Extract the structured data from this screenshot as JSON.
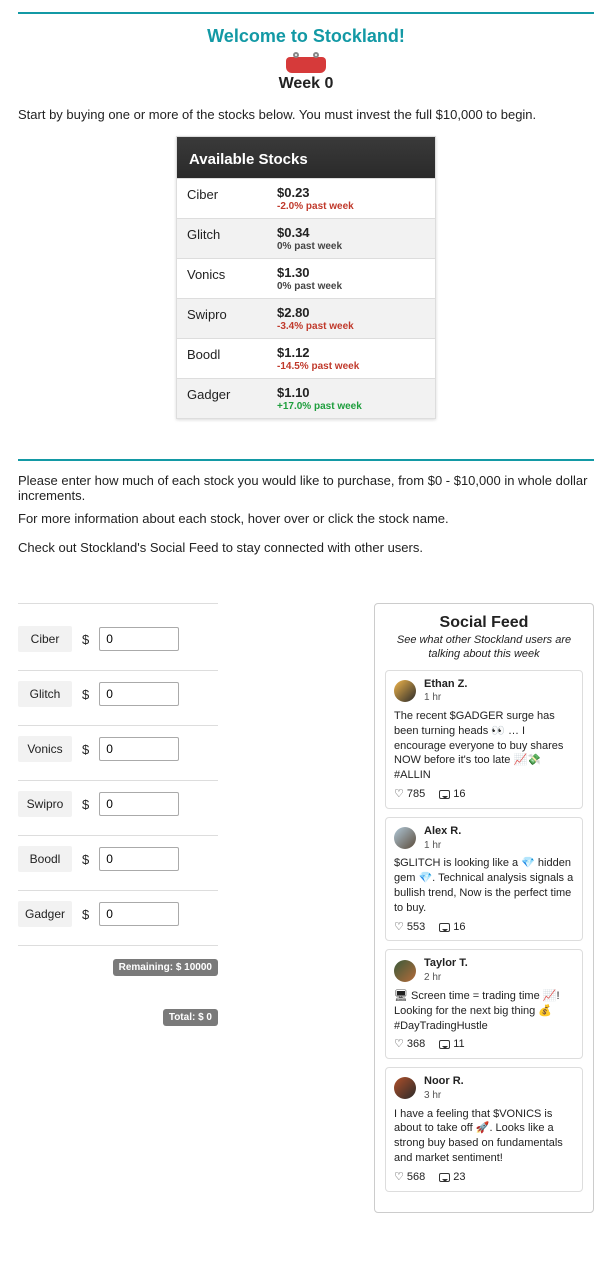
{
  "title": "Welcome to Stockland!",
  "week_label": "Week 0",
  "intro": "Start by buying one or more of the stocks below. You must invest the full $10,000 to begin.",
  "stocks_panel": {
    "heading": "Available Stocks",
    "rows": [
      {
        "name": "Ciber",
        "price": "$0.23",
        "delta": "-2.0% past week",
        "dir": "neg"
      },
      {
        "name": "Glitch",
        "price": "$0.34",
        "delta": "0% past week",
        "dir": "zero"
      },
      {
        "name": "Vonics",
        "price": "$1.30",
        "delta": "0% past week",
        "dir": "zero"
      },
      {
        "name": "Swipro",
        "price": "$2.80",
        "delta": "-3.4% past week",
        "dir": "neg"
      },
      {
        "name": "Boodl",
        "price": "$1.12",
        "delta": "-14.5% past week",
        "dir": "neg"
      },
      {
        "name": "Gadger",
        "price": "$1.10",
        "delta": "+17.0% past week",
        "dir": "pos"
      }
    ]
  },
  "instructions": {
    "line1": "Please enter how much of each stock you would like to purchase, from $0 - $10,000 in whole dollar increments.",
    "line2": "For more information about each stock, hover over or click the stock name.",
    "line3": "Check out Stockland's Social Feed to stay connected with other users."
  },
  "inputs": {
    "currency": "$",
    "rows": [
      {
        "label": "Ciber",
        "value": "0"
      },
      {
        "label": "Glitch",
        "value": "0"
      },
      {
        "label": "Vonics",
        "value": "0"
      },
      {
        "label": "Swipro",
        "value": "0"
      },
      {
        "label": "Boodl",
        "value": "0"
      },
      {
        "label": "Gadger",
        "value": "0"
      }
    ],
    "remaining_label": "Remaining:",
    "remaining_value": "$ 10000",
    "total_label": "Total:",
    "total_value": "$ 0"
  },
  "feed": {
    "title": "Social Feed",
    "subtitle": "See what other Stockland users are talking about this week",
    "posts": [
      {
        "name": "Ethan Z.",
        "time": "1 hr",
        "body": "The recent $GADGER surge has been turning heads 👀 … I encourage everyone to buy shares NOW before it's too late 📈💸 #ALLIN",
        "likes": "785",
        "comments": "16"
      },
      {
        "name": "Alex R.",
        "time": "1 hr",
        "body": "$GLITCH is looking like a 💎 hidden gem 💎. Technical analysis signals a bullish trend, Now is the perfect time to buy.",
        "likes": "553",
        "comments": "16"
      },
      {
        "name": "Taylor T.",
        "time": "2 hr",
        "body": "🖥 Screen time = trading time 📈! Looking for the next big thing 💰 #DayTradingHustle",
        "likes": "368",
        "comments": "11"
      },
      {
        "name": "Noor R.",
        "time": "3 hr",
        "body": "I have a feeling that $VONICS is about to take off 🚀. Looks like a strong buy based on fundamentals and market sentiment!",
        "likes": "568",
        "comments": "23"
      }
    ]
  }
}
